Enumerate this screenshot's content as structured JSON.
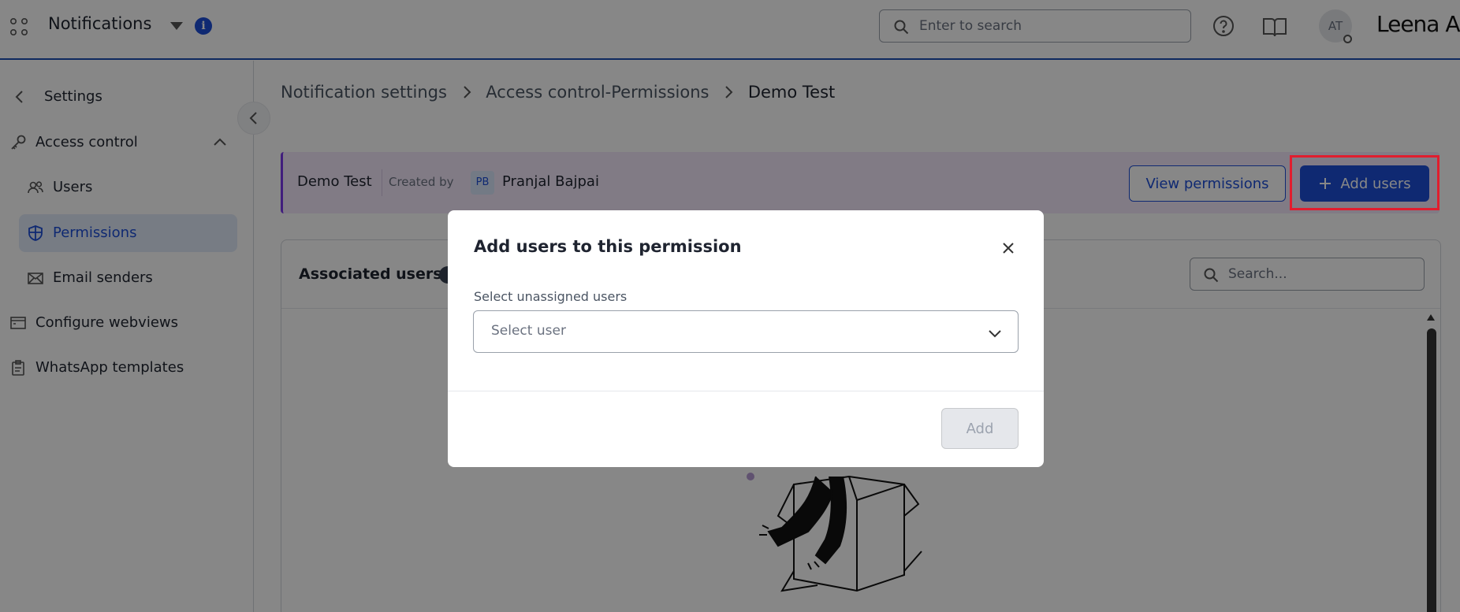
{
  "header": {
    "app_title": "Notifications",
    "search_placeholder": "Enter to search",
    "avatar_initials": "AT",
    "brand": "Leena AI",
    "icons": [
      "apps-grid-icon",
      "caret-down-icon",
      "info-icon",
      "search-icon",
      "help-icon",
      "book-icon"
    ]
  },
  "sidebar": {
    "back_label": "Settings",
    "section_label": "Access control",
    "items": [
      {
        "label": "Users",
        "icon": "users-icon"
      },
      {
        "label": "Permissions",
        "icon": "shield-icon",
        "active": true
      },
      {
        "label": "Email senders",
        "icon": "mail-icon"
      },
      {
        "label": "Configure webviews",
        "icon": "webview-icon"
      },
      {
        "label": "WhatsApp templates",
        "icon": "clipboard-icon"
      }
    ]
  },
  "breadcrumb": [
    "Notification settings",
    "Access control-Permissions",
    "Demo Test"
  ],
  "permission": {
    "name": "Demo Test",
    "created_by_label": "Created by",
    "creator_initials": "PB",
    "creator_name": "Pranjal Bajpai",
    "view_button": "View permissions",
    "add_button": "Add users"
  },
  "users_card": {
    "title": "Associated users",
    "search_placeholder": "Search..."
  },
  "modal": {
    "title": "Add users to this permission",
    "field_label": "Select unassigned users",
    "select_placeholder": "Select user",
    "add_button": "Add"
  },
  "colors": {
    "accent": "#1d4ed8",
    "banner_bg": "#f4e9fb",
    "active_item_bg": "#e1ebf9",
    "highlight": "#e11d2e"
  }
}
